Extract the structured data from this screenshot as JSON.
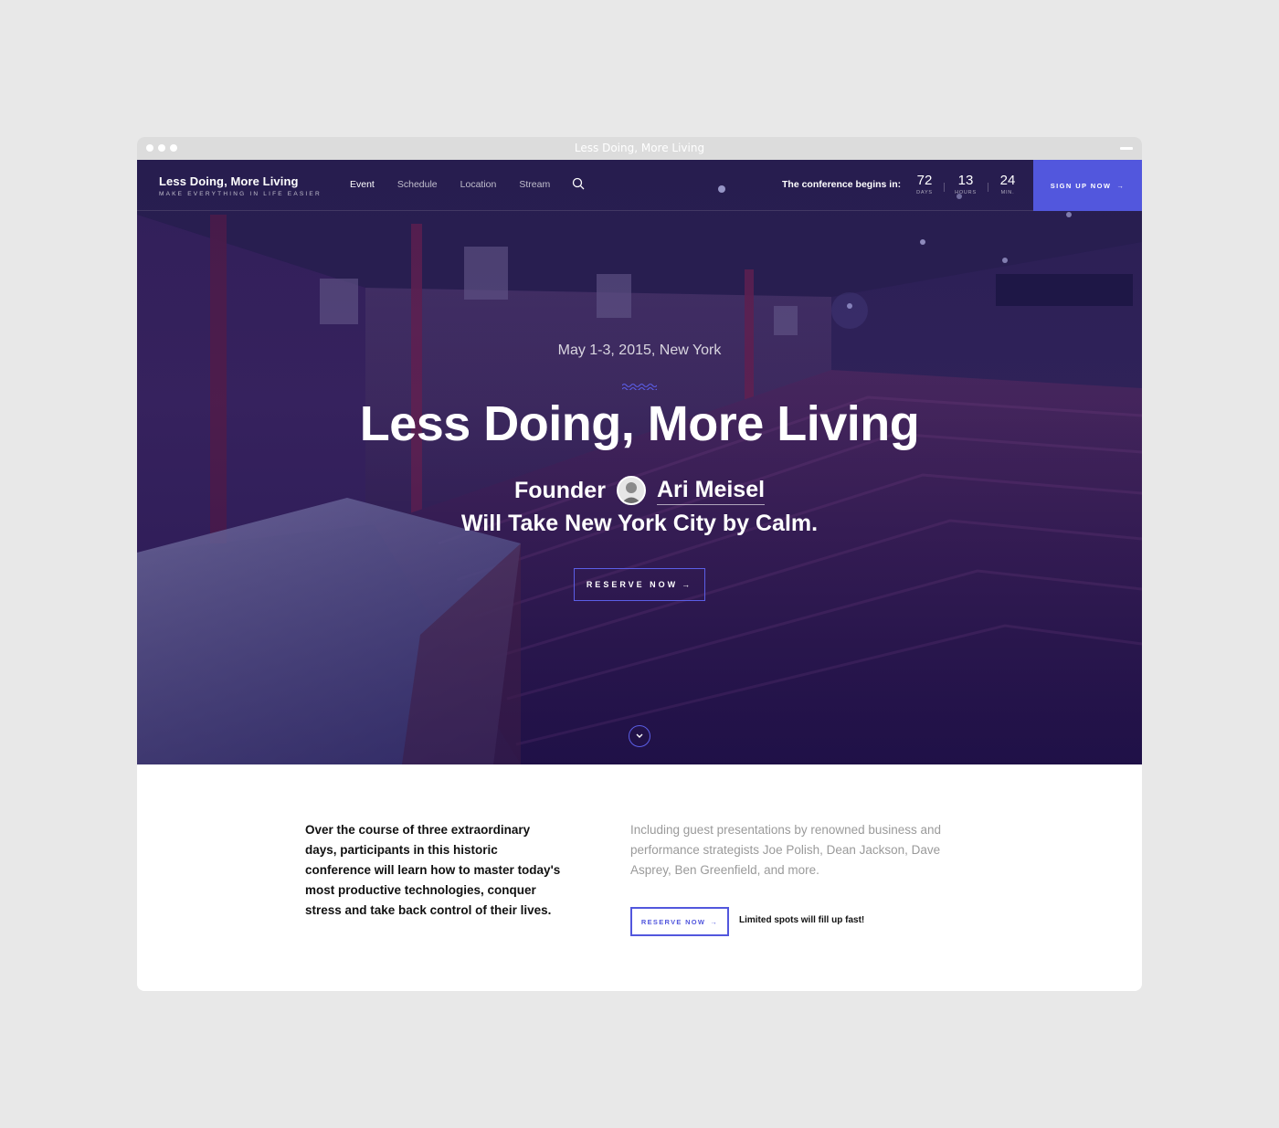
{
  "window": {
    "title": "Less Doing, More Living"
  },
  "nav": {
    "brand_title": "Less Doing, More Living",
    "brand_tagline": "MAKE EVERYTHING IN LIFE EASIER",
    "links": [
      "Event",
      "Schedule",
      "Location",
      "Stream"
    ],
    "active_link": "Event",
    "countdown_label": "The conference begins in:",
    "countdown": [
      {
        "value": "72",
        "unit": "DAYS"
      },
      {
        "value": "13",
        "unit": "HOURS"
      },
      {
        "value": "24",
        "unit": "MIN."
      }
    ],
    "signup_label": "SIGN UP NOW",
    "signup_arrow": "→"
  },
  "hero": {
    "date": "May 1-3, 2015, New York",
    "title": "Less Doing, More Living",
    "founder_label": "Founder",
    "speaker_name": "Ari Meisel",
    "subtitle": "Will Take New York City by Calm.",
    "reserve_label": "RESERVE NOW",
    "reserve_arrow": "→"
  },
  "content": {
    "lead": "Over the course of three extraordinary days, participants in this historic conference will learn how to master today's most productive technologies, conquer stress and take back control of their lives.",
    "secondary": "Including guest presentations by renowned business and performance strategists Joe Polish, Dean Jackson, Dave Asprey, Ben Greenfield, and more.",
    "reserve_label": "RESERVE NOW",
    "reserve_arrow": "→",
    "limited_note": "Limited spots will fill up fast!"
  },
  "colors": {
    "accent": "#5257dd",
    "hero_dark": "#1c1448"
  },
  "icons": [
    "search-icon",
    "wave-icon",
    "chevron-down-icon",
    "avatar"
  ]
}
